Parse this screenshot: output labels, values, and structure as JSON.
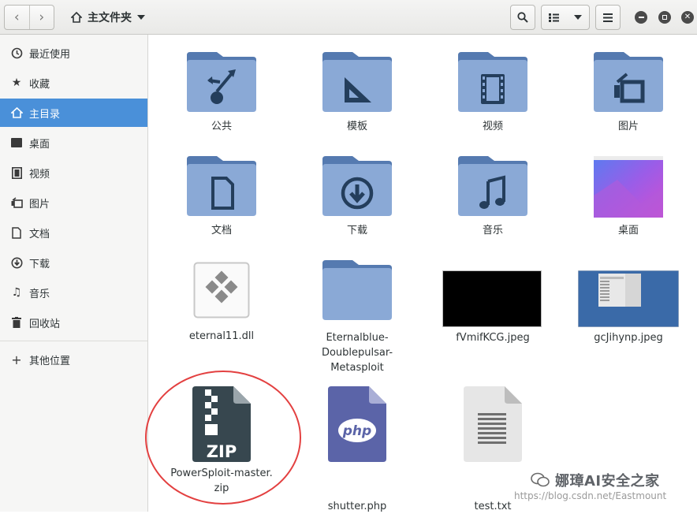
{
  "header": {
    "location": "主文件夹",
    "icons": [
      "back-icon",
      "forward-icon",
      "home-icon",
      "search-icon",
      "list-view-icon",
      "menu-icon",
      "minimize-icon",
      "maximize-icon",
      "close-icon"
    ]
  },
  "sidebar": {
    "items": [
      {
        "label": "最近使用",
        "icon": "clock-icon"
      },
      {
        "label": "收藏",
        "icon": "star-icon"
      },
      {
        "label": "主目录",
        "icon": "home-icon"
      },
      {
        "label": "桌面",
        "icon": "desktop-icon"
      },
      {
        "label": "视频",
        "icon": "video-icon"
      },
      {
        "label": "图片",
        "icon": "picture-icon"
      },
      {
        "label": "文档",
        "icon": "document-icon"
      },
      {
        "label": "下载",
        "icon": "download-icon"
      },
      {
        "label": "音乐",
        "icon": "music-icon"
      },
      {
        "label": "回收站",
        "icon": "trash-icon"
      }
    ],
    "other": "其他位置",
    "active": "主目录"
  },
  "files": [
    {
      "name": "公共",
      "type": "folder-public"
    },
    {
      "name": "模板",
      "type": "folder-templates"
    },
    {
      "name": "视频",
      "type": "folder-videos"
    },
    {
      "name": "图片",
      "type": "folder-pictures"
    },
    {
      "name": "文档",
      "type": "folder-documents"
    },
    {
      "name": "下载",
      "type": "folder-downloads"
    },
    {
      "name": "音乐",
      "type": "folder-music"
    },
    {
      "name": "桌面",
      "type": "desktop-thumbnail"
    },
    {
      "name": "eternal11.dll",
      "type": "dll"
    },
    {
      "name1": "Eternalblue-",
      "name2": "Doublepulsar-",
      "name3": "Metasploit",
      "type": "folder"
    },
    {
      "name": "fVmifKCG.jpeg",
      "type": "image-black"
    },
    {
      "name": "gcJihynp.jpeg",
      "type": "image-screenshot"
    },
    {
      "name1": "PowerSploit-master.",
      "name2": "zip",
      "type": "zip",
      "icon_text": "ZIP"
    },
    {
      "name": "shutter.php",
      "type": "php",
      "icon_text": "php"
    },
    {
      "name": "test.txt",
      "type": "text"
    }
  ],
  "watermark": {
    "text": "娜璋AI安全之家",
    "url": "https://blog.csdn.net/Eastmount"
  },
  "colors": {
    "folder": "#8aa9d6",
    "folder_tab": "#557ab0",
    "accent": "#4a90d9",
    "callout": "#e34040"
  }
}
